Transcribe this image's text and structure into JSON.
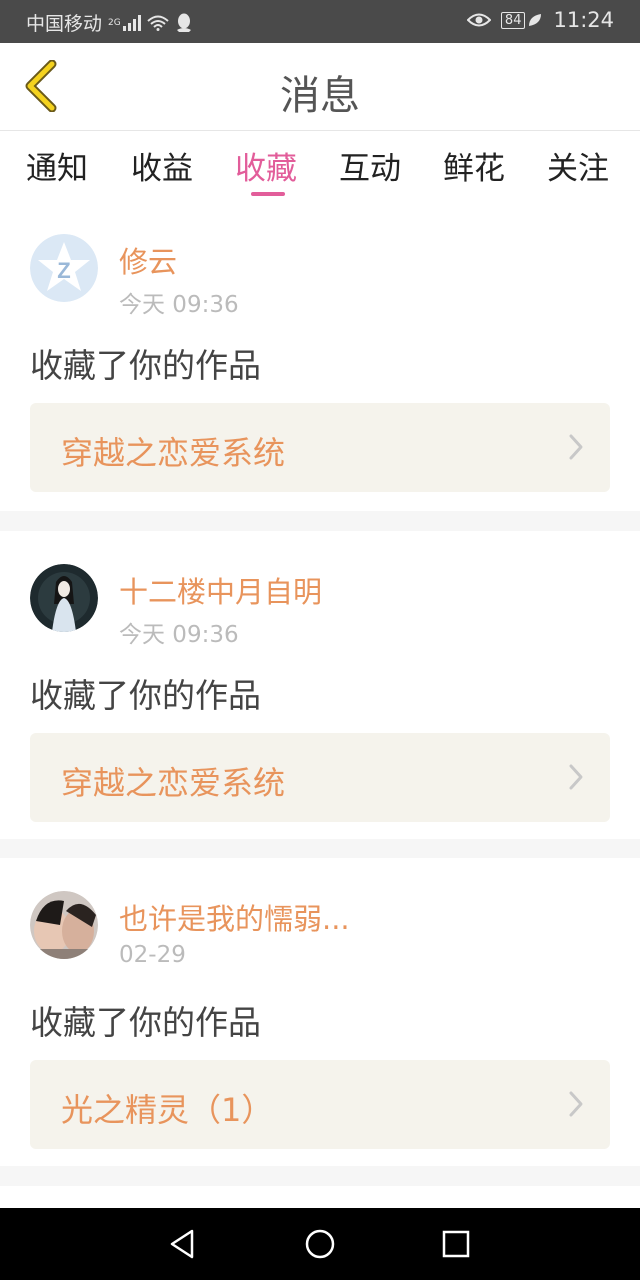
{
  "status_bar": {
    "carrier": "中国移动",
    "network": "2G",
    "battery": "84",
    "time": "11:24"
  },
  "header": {
    "title": "消息"
  },
  "tabs": [
    {
      "label": "通知"
    },
    {
      "label": "收益"
    },
    {
      "label": "收藏"
    },
    {
      "label": "互动"
    },
    {
      "label": "鲜花"
    },
    {
      "label": "关注"
    }
  ],
  "active_tab": "收藏",
  "colors": {
    "accent": "#e25d9a",
    "name": "#e8945c",
    "work_bg": "#f5f3ec"
  },
  "messages": [
    {
      "user": "修云",
      "time": "今天 09:36",
      "action": "收藏了你的作品",
      "work": "穿越之恋爱系统",
      "avatar": "qq-default-avatar"
    },
    {
      "user": "十二楼中月自明",
      "time": "今天 09:36",
      "action": "收藏了你的作品",
      "work": "穿越之恋爱系统",
      "avatar": "user-photo-avatar"
    },
    {
      "user": "也许是我的懦弱...",
      "time": "02-29",
      "action": "收藏了你的作品",
      "work": "光之精灵（1）",
      "avatar": "user-photo-avatar"
    }
  ]
}
